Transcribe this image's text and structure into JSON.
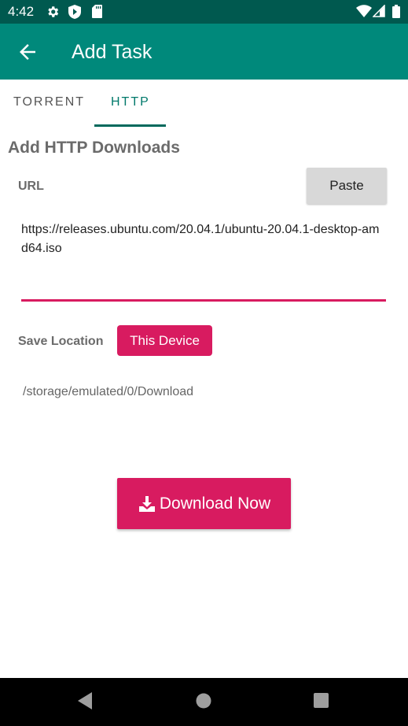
{
  "status_bar": {
    "time": "4:42",
    "left_icons": [
      "gear-icon",
      "shield-play-icon",
      "sd-card-icon"
    ],
    "right_icons": [
      "wifi-icon",
      "signal-icon",
      "battery-icon"
    ]
  },
  "app_bar": {
    "title": "Add Task",
    "back_icon": "arrow-left-icon"
  },
  "tabs": [
    {
      "label": "TORRENT",
      "selected": false
    },
    {
      "label": "HTTP",
      "selected": true
    }
  ],
  "form": {
    "section_title": "Add HTTP Downloads",
    "url_label": "URL",
    "paste_label": "Paste",
    "url_value": "https://releases.ubuntu.com/20.04.1/ubuntu-20.04.1-desktop-amd64.iso",
    "save_location_label": "Save Location",
    "location_button_label": "This Device",
    "save_path": "/storage/emulated/0/Download",
    "download_button_label": "Download Now"
  },
  "colors": {
    "primary": "#00897b",
    "primary_dark": "#00594f",
    "accent": "#d81b60"
  },
  "nav_bar": {
    "buttons": [
      "back-icon",
      "home-icon",
      "recents-icon"
    ]
  }
}
